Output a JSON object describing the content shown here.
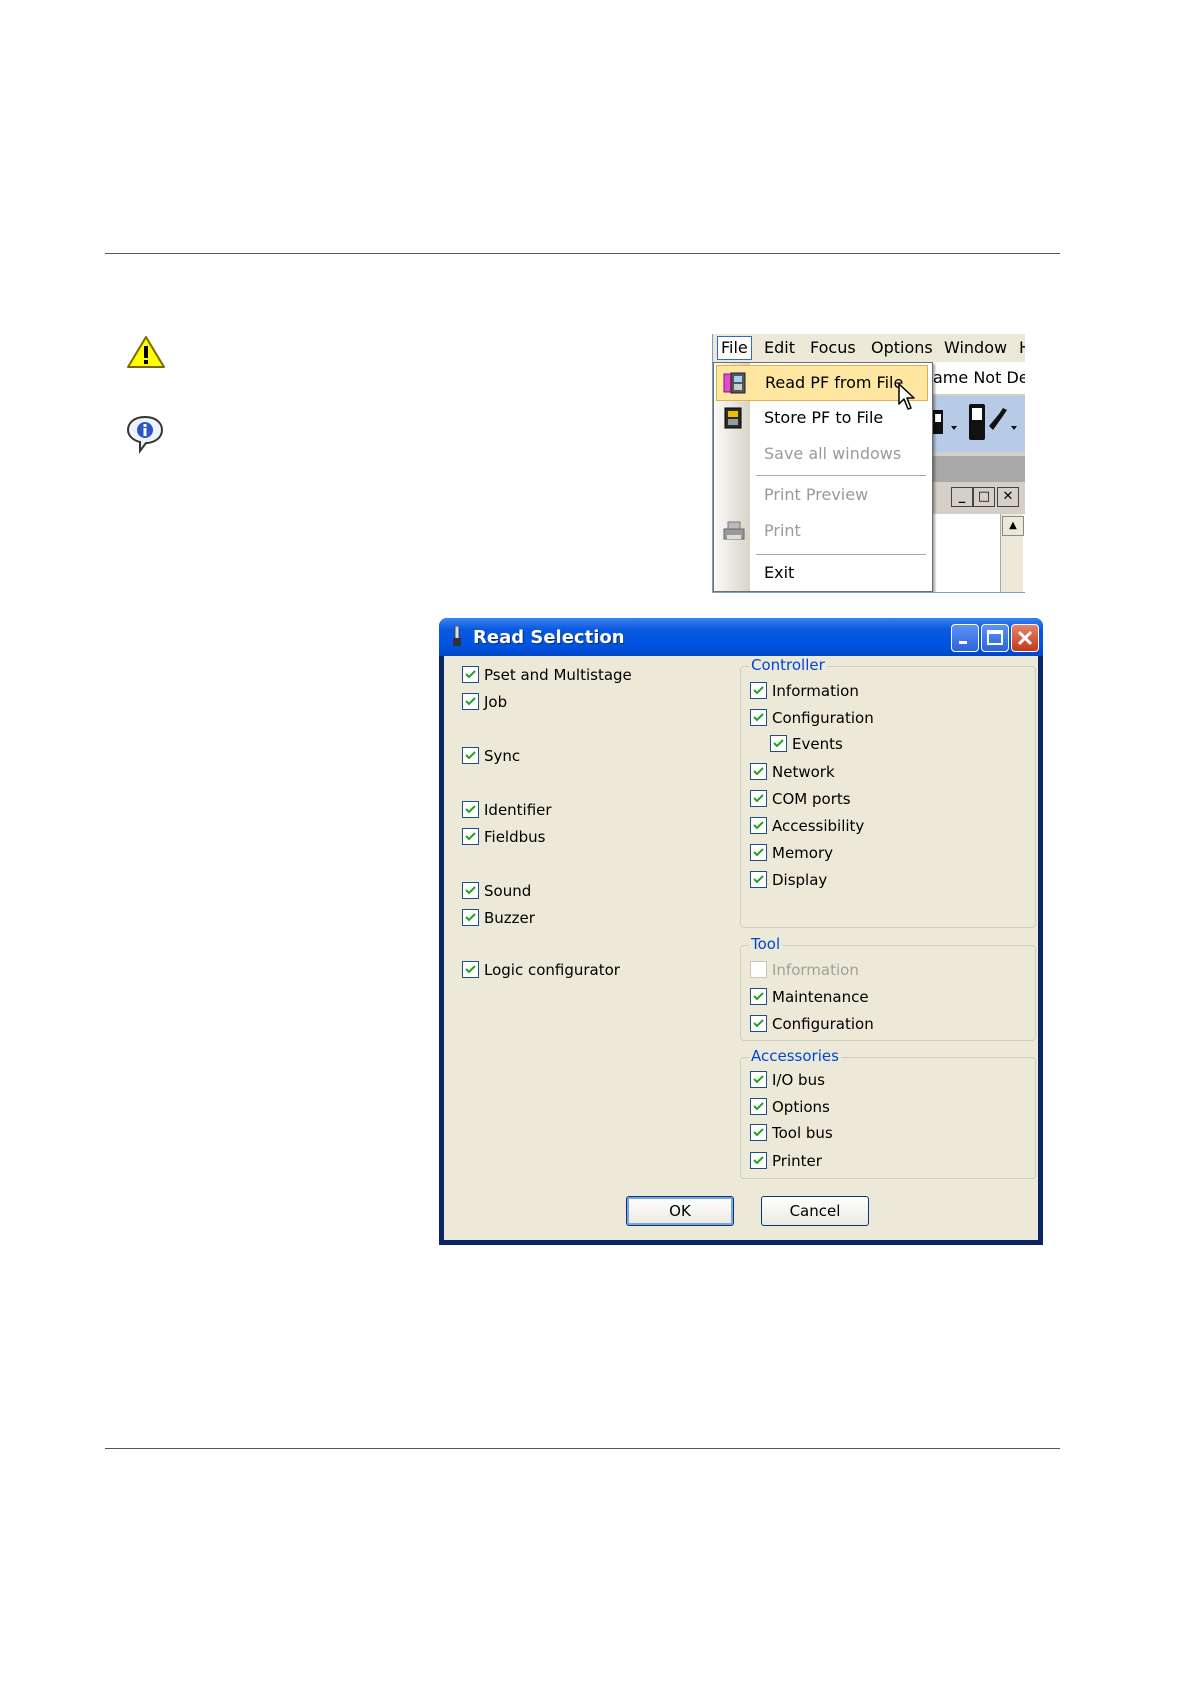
{
  "menu": {
    "bar": [
      {
        "label": "File"
      },
      {
        "label": "Edit"
      },
      {
        "label": "Focus"
      },
      {
        "label": "Options"
      },
      {
        "label": "Window"
      },
      {
        "label": "H"
      }
    ],
    "background": {
      "title_fragment": "ame Not Def",
      "window_buttons": [
        "_",
        "□",
        "✕"
      ]
    },
    "items": [
      {
        "label": "Read PF from File",
        "state": "highlighted",
        "icon": "read-file-icon"
      },
      {
        "label": "Store PF to File",
        "state": "enabled",
        "icon": "store-file-icon"
      },
      {
        "label": "Save all windows",
        "state": "disabled"
      },
      {
        "label": "Print Preview",
        "state": "disabled"
      },
      {
        "label": "Print",
        "state": "disabled",
        "icon": "printer-icon"
      },
      {
        "label": "Exit",
        "state": "enabled"
      }
    ]
  },
  "dialog": {
    "title": "Read Selection",
    "left_options": [
      {
        "label": "Pset and Multistage",
        "checked": true
      },
      {
        "label": "Job",
        "checked": true
      },
      {
        "label": "Sync",
        "checked": true
      },
      {
        "label": "Identifier",
        "checked": true
      },
      {
        "label": "Fieldbus",
        "checked": true
      },
      {
        "label": "Sound",
        "checked": true
      },
      {
        "label": "Buzzer",
        "checked": true
      },
      {
        "label": "Logic configurator",
        "checked": true
      }
    ],
    "controller": {
      "title": "Controller",
      "items": [
        {
          "label": "Information",
          "checked": true
        },
        {
          "label": "Configuration",
          "checked": true
        },
        {
          "label": "Events",
          "checked": true
        },
        {
          "label": "Network",
          "checked": true
        },
        {
          "label": "COM ports",
          "checked": true
        },
        {
          "label": "Accessibility",
          "checked": true
        },
        {
          "label": "Memory",
          "checked": true
        },
        {
          "label": "Display",
          "checked": true
        }
      ]
    },
    "tool": {
      "title": "Tool",
      "items": [
        {
          "label": "Information",
          "checked": false,
          "disabled": true
        },
        {
          "label": "Maintenance",
          "checked": true
        },
        {
          "label": "Configuration",
          "checked": true
        }
      ]
    },
    "accessories": {
      "title": "Accessories",
      "items": [
        {
          "label": "I/O bus",
          "checked": true
        },
        {
          "label": "Options",
          "checked": true
        },
        {
          "label": "Tool bus",
          "checked": true
        },
        {
          "label": "Printer",
          "checked": true
        }
      ]
    },
    "ok_label": "OK",
    "cancel_label": "Cancel"
  },
  "colors": {
    "titlebar": "#0054e3",
    "group_title": "#0046d5",
    "dialog_bg": "#ece9d8",
    "warning": "#ffff00"
  }
}
